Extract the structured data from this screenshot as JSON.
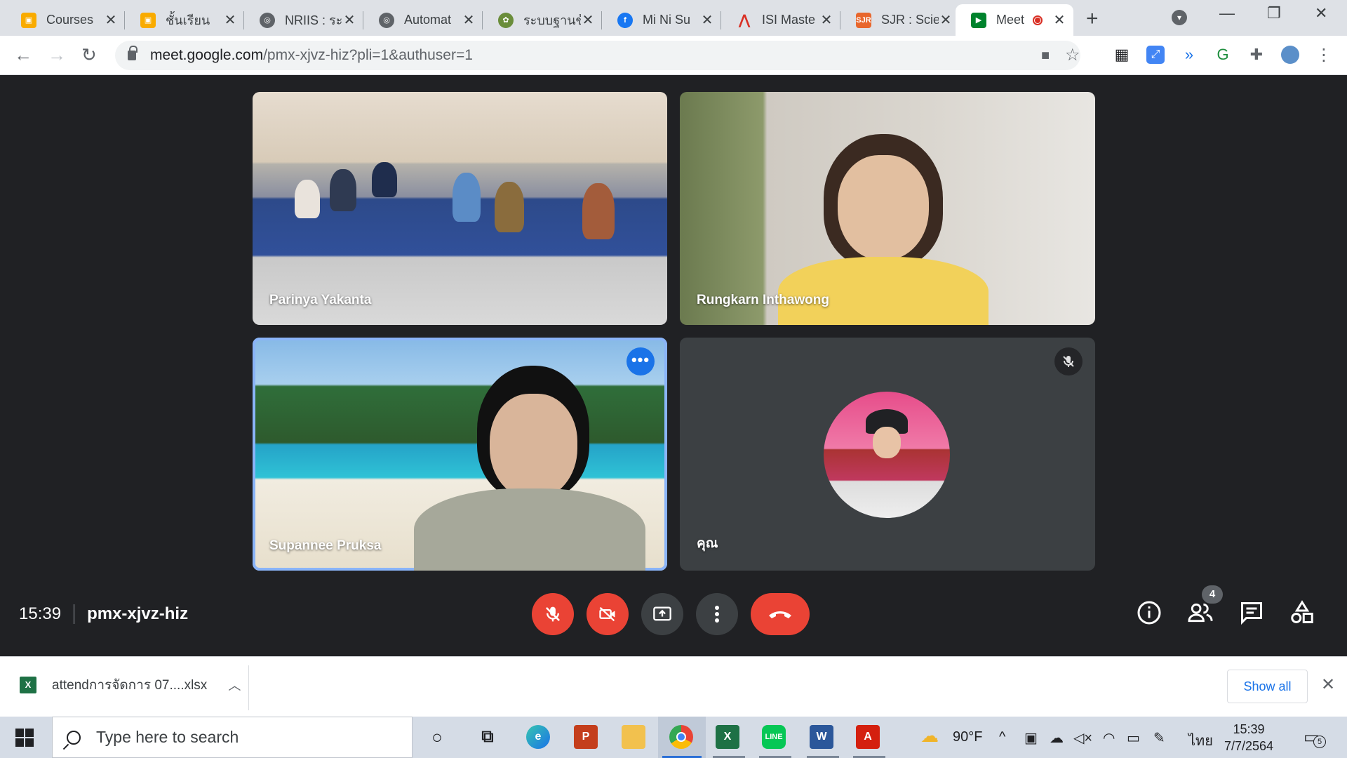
{
  "browser": {
    "tabs": [
      {
        "title": "Courses",
        "favicon": "classroom-icon"
      },
      {
        "title": "ชั้นเรียน",
        "favicon": "classroom-icon"
      },
      {
        "title": "NRIIS : ระ",
        "favicon": "globe-icon"
      },
      {
        "title": "Automat",
        "favicon": "globe-icon"
      },
      {
        "title": "ระบบฐานข้",
        "favicon": "seal-icon"
      },
      {
        "title": "Mi Ni Su",
        "favicon": "facebook-icon"
      },
      {
        "title": "ISI Maste",
        "favicon": "isi-icon"
      },
      {
        "title": "SJR : Scie",
        "favicon": "sjr-icon"
      },
      {
        "title": "Meet",
        "favicon": "meet-icon",
        "active": true,
        "recording": true
      }
    ],
    "url_host": "meet.google.com",
    "url_path": "/pmx-xjvz-hiz?pli=1&authuser=1"
  },
  "meet": {
    "participants": [
      {
        "name": "Parinya Yakanta"
      },
      {
        "name": "Rungkarn Inthawong"
      },
      {
        "name": "Supannee Pruksa",
        "speaking": true
      },
      {
        "name": "คุณ",
        "muted": true
      }
    ],
    "time": "15:39",
    "meeting_code": "pmx-xjvz-hiz",
    "people_count": "4"
  },
  "download": {
    "filename": "attendการจัดการ 07....xlsx",
    "show_all": "Show all"
  },
  "taskbar": {
    "search_placeholder": "Type here to search",
    "weather": "90°F",
    "language": "ไทย",
    "clock_time": "15:39",
    "clock_date": "7/7/2564",
    "notification_count": "5"
  },
  "colors": {
    "accent": "#1a73e8",
    "danger": "#ea4335",
    "speaking_outline": "#8ab4f8",
    "stage_bg": "#202124"
  }
}
